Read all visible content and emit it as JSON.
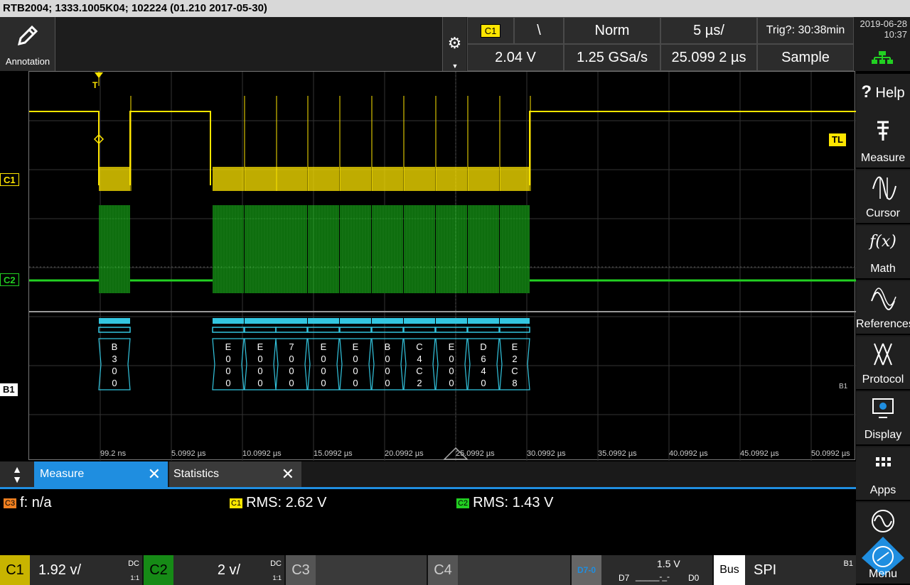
{
  "titlebar": "RTB2004; 1333.1005K04; 102224 (01.210 2017-05-30)",
  "annotation": {
    "label": "Annotation"
  },
  "trigger": {
    "source": "C1",
    "slope_symbol": "\\",
    "mode": "Norm",
    "timebase": "5 µs/",
    "trig_status": "Trig?: 30:38min",
    "level": "2.04 V",
    "sample_rate": "1.25 GSa/s",
    "position": "25.099 2 µs",
    "acq_mode": "Sample"
  },
  "datetime": {
    "date": "2019-06-28",
    "time": "10:37"
  },
  "sidebar": [
    {
      "label": "Help",
      "icon": "help-icon"
    },
    {
      "label": "Measure",
      "icon": "measure-icon"
    },
    {
      "label": "Cursor",
      "icon": "cursor-icon"
    },
    {
      "label": "Math",
      "icon": "math-icon"
    },
    {
      "label": "References",
      "icon": "references-icon"
    },
    {
      "label": "Protocol",
      "icon": "protocol-icon"
    },
    {
      "label": "Display",
      "icon": "display-icon"
    },
    {
      "label": "Apps",
      "icon": "apps-icon"
    },
    {
      "label": "Menu",
      "icon": "rs-logo-icon"
    }
  ],
  "help_prefix": "?",
  "math_glyph": "f(x)",
  "markers": {
    "c1": "C1",
    "c2": "C2",
    "b1": "B1",
    "tl": "TL",
    "trig": "T",
    "b1_right": "B1"
  },
  "colors": {
    "c1": "#ffe600",
    "c2": "#22d022",
    "bus": "#33c6e0",
    "math": "#f08020",
    "accent": "#1f8ee0"
  },
  "time_labels": [
    "99.2 ns",
    "5.0992 µs",
    "10.0992 µs",
    "15.0992 µs",
    "20.0992 µs",
    "25.0992 µs",
    "30.0992 µs",
    "35.0992 µs",
    "40.0992 µs",
    "45.0992 µs",
    "50.0992 µs"
  ],
  "decode_frames": [
    [
      "B",
      "3",
      "0",
      "0"
    ],
    [
      "E",
      "0",
      "0",
      "0"
    ],
    [
      "E",
      "0",
      "0",
      "0"
    ],
    [
      "7",
      "0",
      "0",
      "0"
    ],
    [
      "E",
      "0",
      "0",
      "0"
    ],
    [
      "E",
      "0",
      "0",
      "0"
    ],
    [
      "B",
      "0",
      "0",
      "0"
    ],
    [
      "C",
      "4",
      "C",
      "2"
    ],
    [
      "E",
      "0",
      "0",
      "0"
    ],
    [
      "D",
      "6",
      "4",
      "0"
    ],
    [
      "E",
      "2",
      "C",
      "8"
    ]
  ],
  "tabs": {
    "measure": "Measure",
    "statistics": "Statistics",
    "close": "✕"
  },
  "measurements": [
    {
      "tag": "C3",
      "text": "f: n/a"
    },
    {
      "tag": "C1",
      "text": "RMS: 2.62 V"
    },
    {
      "tag": "C2",
      "text": "RMS: 1.43 V"
    }
  ],
  "channels": {
    "c1": {
      "name": "C1",
      "scale": "1.92 v/",
      "coupling": "DC",
      "ratio": "1:1"
    },
    "c2": {
      "name": "C2",
      "scale": "2 v/",
      "coupling": "DC",
      "ratio": "1:1"
    },
    "c3": {
      "name": "C3"
    },
    "c4": {
      "name": "C4"
    },
    "logic": {
      "name": "D7-0",
      "level": "1.5 V",
      "d7": "D7",
      "d0": "D0",
      "pattern": "_____-_-"
    },
    "bus": {
      "label": "Bus",
      "protocol": "SPI",
      "id": "B1"
    }
  }
}
